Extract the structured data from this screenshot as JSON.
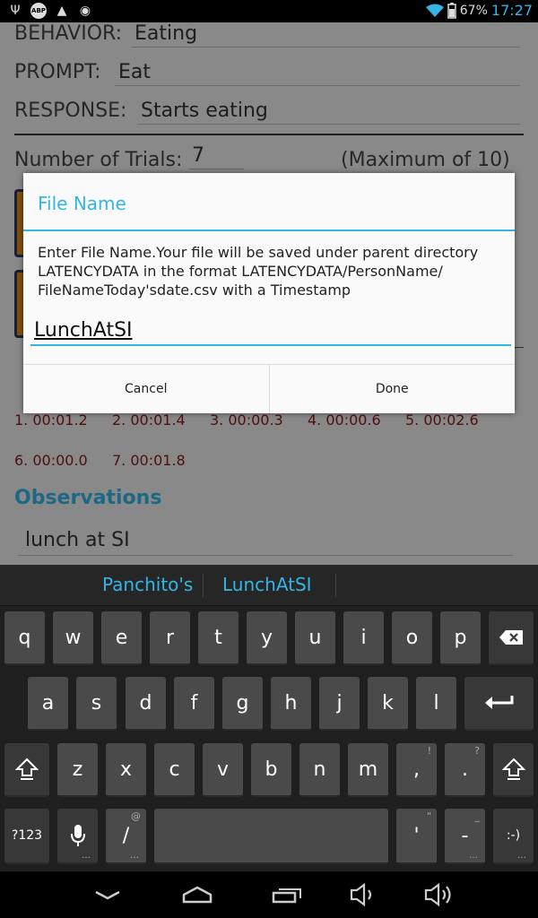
{
  "status_bar": {
    "left_icons": [
      "usb-icon",
      "adblock-icon",
      "warning-icon",
      "android-debug-icon"
    ],
    "abp_text": "ABP",
    "battery_percent": "67%",
    "time": "17:27"
  },
  "form": {
    "behavior_label": "BEHAVIOR:",
    "behavior_value": "Eating",
    "prompt_label": "PROMPT:",
    "prompt_value": "Eat",
    "response_label": "RESPONSE:",
    "response_value": "Starts eating",
    "trials_label": "Number of Trials:",
    "trials_value": "7",
    "trials_max": "(Maximum of 10)"
  },
  "latencies": [
    "1. 00:01.2",
    "2. 00:01.4",
    "3. 00:00.3",
    "4. 00:00.6",
    "5. 00:02.6",
    "6. 00:00.0",
    "7. 00:01.8"
  ],
  "observations": {
    "title": "Observations",
    "value": "lunch at SI"
  },
  "dialog": {
    "title": "File Name",
    "message": "Enter File Name.Your file will be saved under parent directory\nLATENCYDATA in the format LATENCYDATA/PersonName/\nFileNameToday'sdate.csv with a Timestamp",
    "input_value": "LunchAtSI",
    "cancel_label": "Cancel",
    "done_label": "Done"
  },
  "keyboard": {
    "suggestions": [
      "Panchito's",
      "LunchAtSI"
    ],
    "row1": [
      "q",
      "w",
      "e",
      "r",
      "t",
      "y",
      "u",
      "i",
      "o",
      "p"
    ],
    "row2": [
      "a",
      "s",
      "d",
      "f",
      "g",
      "h",
      "j",
      "k",
      "l"
    ],
    "row3": [
      "z",
      "x",
      "c",
      "v",
      "b",
      "n",
      "m",
      ",",
      "."
    ],
    "row3_hints": [
      "",
      "",
      "",
      "",
      "",
      "",
      "",
      "!",
      "?"
    ],
    "numbers_label": "?123",
    "slash_label": "/",
    "slash_hint": "@",
    "apostrophe_label": "'",
    "apostrophe_hint": "\"",
    "dash_label": "-",
    "dash_hint": "_",
    "smiley_label": ":-)",
    "accent_color": "#33b5e5"
  },
  "nav_bar": {
    "icons": [
      "back-icon",
      "home-icon",
      "recent-apps-icon",
      "volume-down-icon",
      "volume-up-icon"
    ]
  }
}
